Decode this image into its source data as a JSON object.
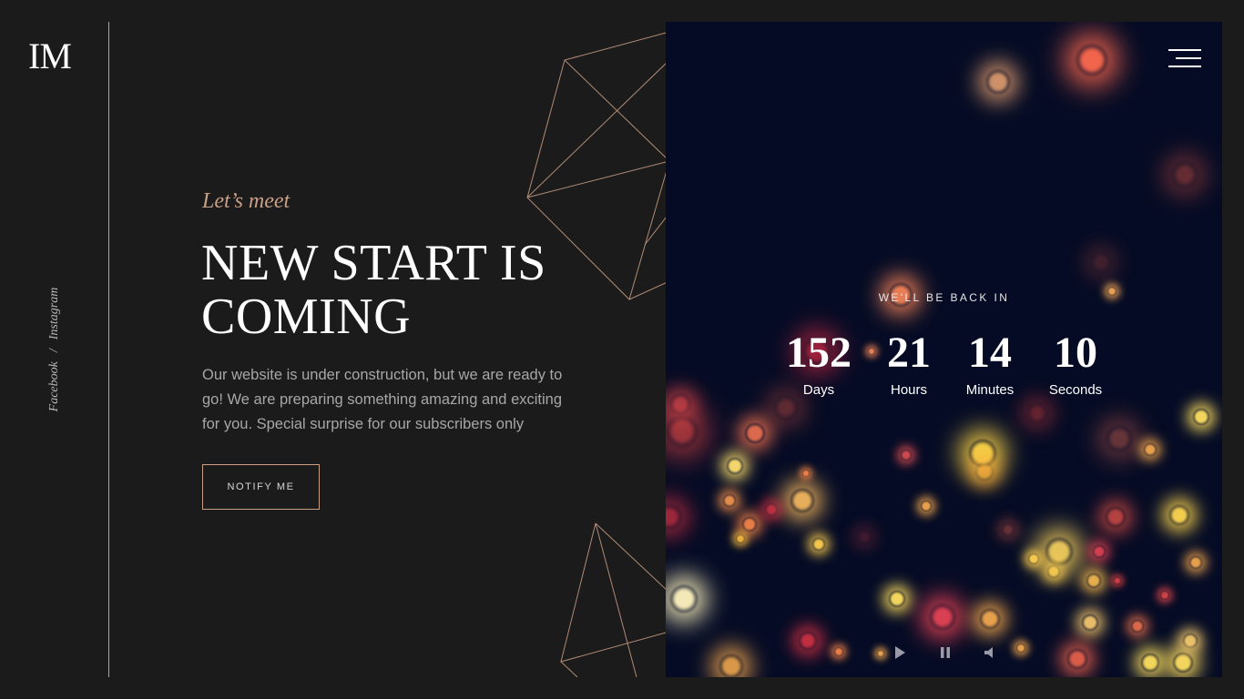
{
  "brand": {
    "logo": "IM"
  },
  "social": {
    "facebook": "Facebook",
    "separator": "/",
    "instagram": "Instagram"
  },
  "hero": {
    "eyebrow": "Let’s meet",
    "headline_line1": "NEW START IS",
    "headline_line2": "COMING",
    "description": "Our website is under construction, but we are ready to go! We are preparing something amazing and exciting for you. Special surprise for our subscribers only",
    "notify_label": "NOTIFY ME"
  },
  "countdown": {
    "heading": "WE'LL BE BACK IN",
    "days": {
      "value": "152",
      "label": "Days"
    },
    "hours": {
      "value": "21",
      "label": "Hours"
    },
    "minutes": {
      "value": "14",
      "label": "Minutes"
    },
    "seconds": {
      "value": "10",
      "label": "Seconds"
    }
  },
  "icons": {
    "menu": "hamburger-menu-icon",
    "play": "play-icon",
    "pause": "pause-icon",
    "volume": "volume-icon"
  },
  "colors": {
    "accent": "#c99f86",
    "background": "#1b1b1b",
    "panel": "#050b24",
    "text": "#ffffff"
  }
}
